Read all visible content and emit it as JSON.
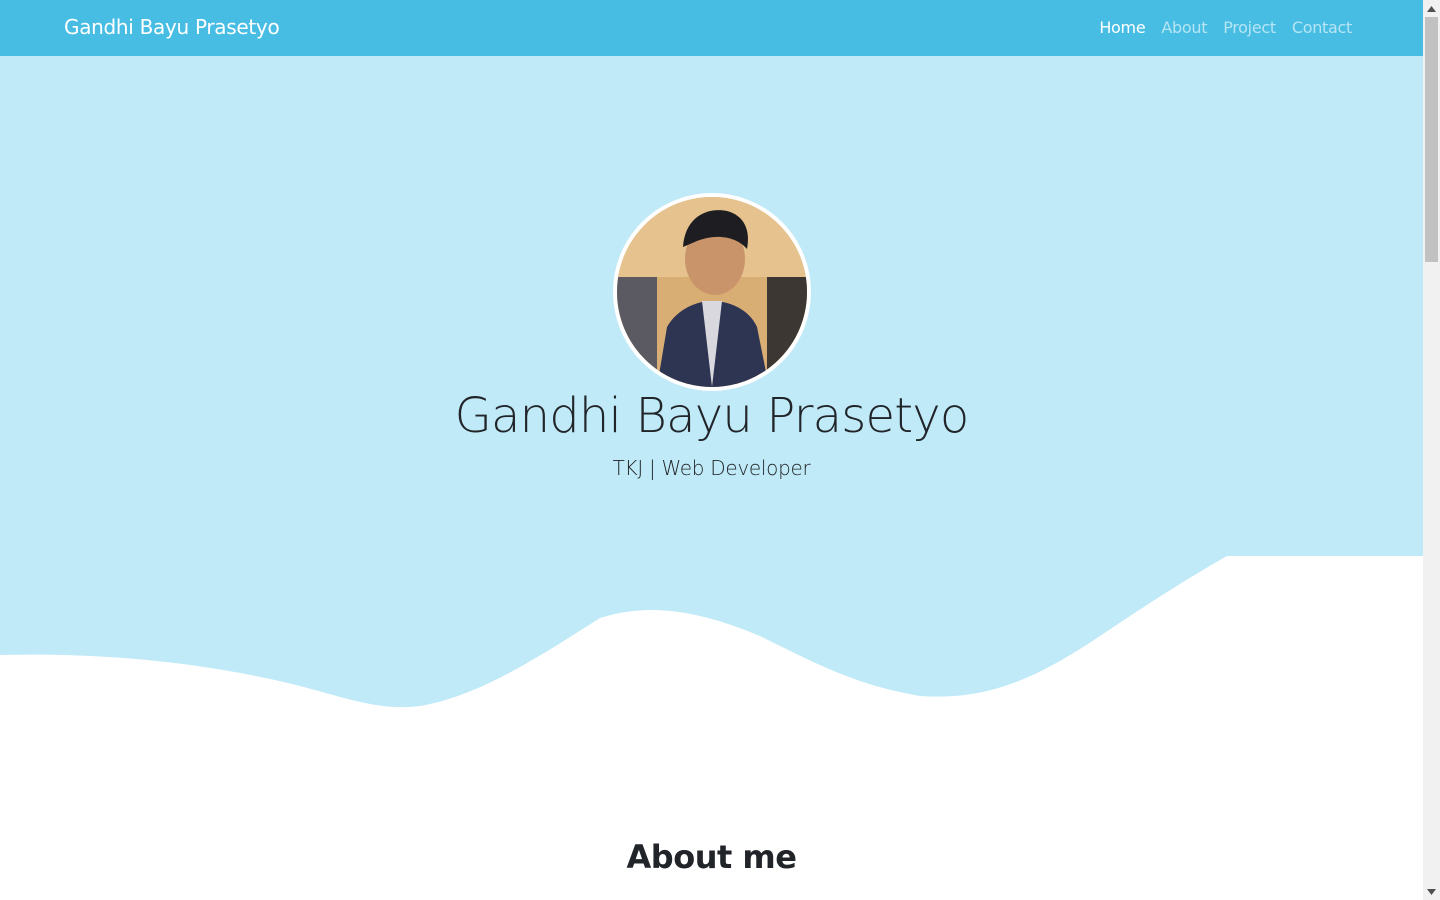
{
  "navbar": {
    "brand": "Gandhi Bayu Prasetyo",
    "links": [
      {
        "label": "Home",
        "active": true
      },
      {
        "label": "About",
        "active": false
      },
      {
        "label": "Project",
        "active": false
      },
      {
        "label": "Contact",
        "active": false
      }
    ]
  },
  "hero": {
    "name": "Gandhi Bayu Prasetyo",
    "subtitle": "TKJ | Web Developer",
    "avatar_alt": "profile photo"
  },
  "about": {
    "title": "About me"
  },
  "colors": {
    "navbar": "#48bde3",
    "hero_bg": "#c0eaf7",
    "wave": "#ffffff",
    "text": "#212529"
  },
  "icons": {
    "scroll_up": "triangle-up-icon",
    "scroll_down": "triangle-down-icon"
  }
}
